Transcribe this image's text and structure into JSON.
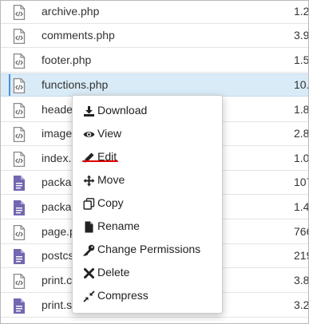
{
  "files": [
    {
      "name": "archive.php",
      "size": "1.2",
      "icon": "php-file-icon"
    },
    {
      "name": "comments.php",
      "size": "3.9",
      "icon": "php-file-icon"
    },
    {
      "name": "footer.php",
      "size": "1.5",
      "icon": "php-file-icon"
    },
    {
      "name": "functions.php",
      "size": "10.",
      "icon": "php-file-icon",
      "selected": true
    },
    {
      "name": "heade",
      "size": "1.8",
      "icon": "php-file-icon"
    },
    {
      "name": "image",
      "size": "2.8",
      "icon": "php-file-icon"
    },
    {
      "name": "index.",
      "size": "1.0",
      "icon": "php-file-icon"
    },
    {
      "name": "packa",
      "size": "107",
      "icon": "package-file-icon"
    },
    {
      "name": "packa",
      "size": "1.4",
      "icon": "package-file-icon"
    },
    {
      "name": "page.p",
      "size": "766",
      "icon": "php-file-icon"
    },
    {
      "name": "postcs",
      "size": "219",
      "icon": "package-file-icon"
    },
    {
      "name": "print.c",
      "size": "3.8",
      "icon": "php-file-icon"
    },
    {
      "name": "print.s",
      "size": "3.2",
      "icon": "package-file-icon"
    }
  ],
  "context_menu": {
    "items": [
      {
        "label": "Download",
        "icon": "download-icon"
      },
      {
        "label": "View",
        "icon": "eye-icon"
      },
      {
        "label": "Edit",
        "icon": "pencil-icon",
        "highlighted": true
      },
      {
        "label": "Move",
        "icon": "move-arrows-icon"
      },
      {
        "label": "Copy",
        "icon": "copy-icon"
      },
      {
        "label": "Rename",
        "icon": "file-rename-icon"
      },
      {
        "label": "Change Permissions",
        "icon": "key-icon"
      },
      {
        "label": "Delete",
        "icon": "x-icon"
      },
      {
        "label": "Compress",
        "icon": "compress-icon"
      }
    ]
  },
  "colors": {
    "selected_row": "#d9ebf7",
    "php_icon": "#8a8a8a",
    "package_icon": "#7466b0",
    "highlight_underline": "#e00000"
  }
}
